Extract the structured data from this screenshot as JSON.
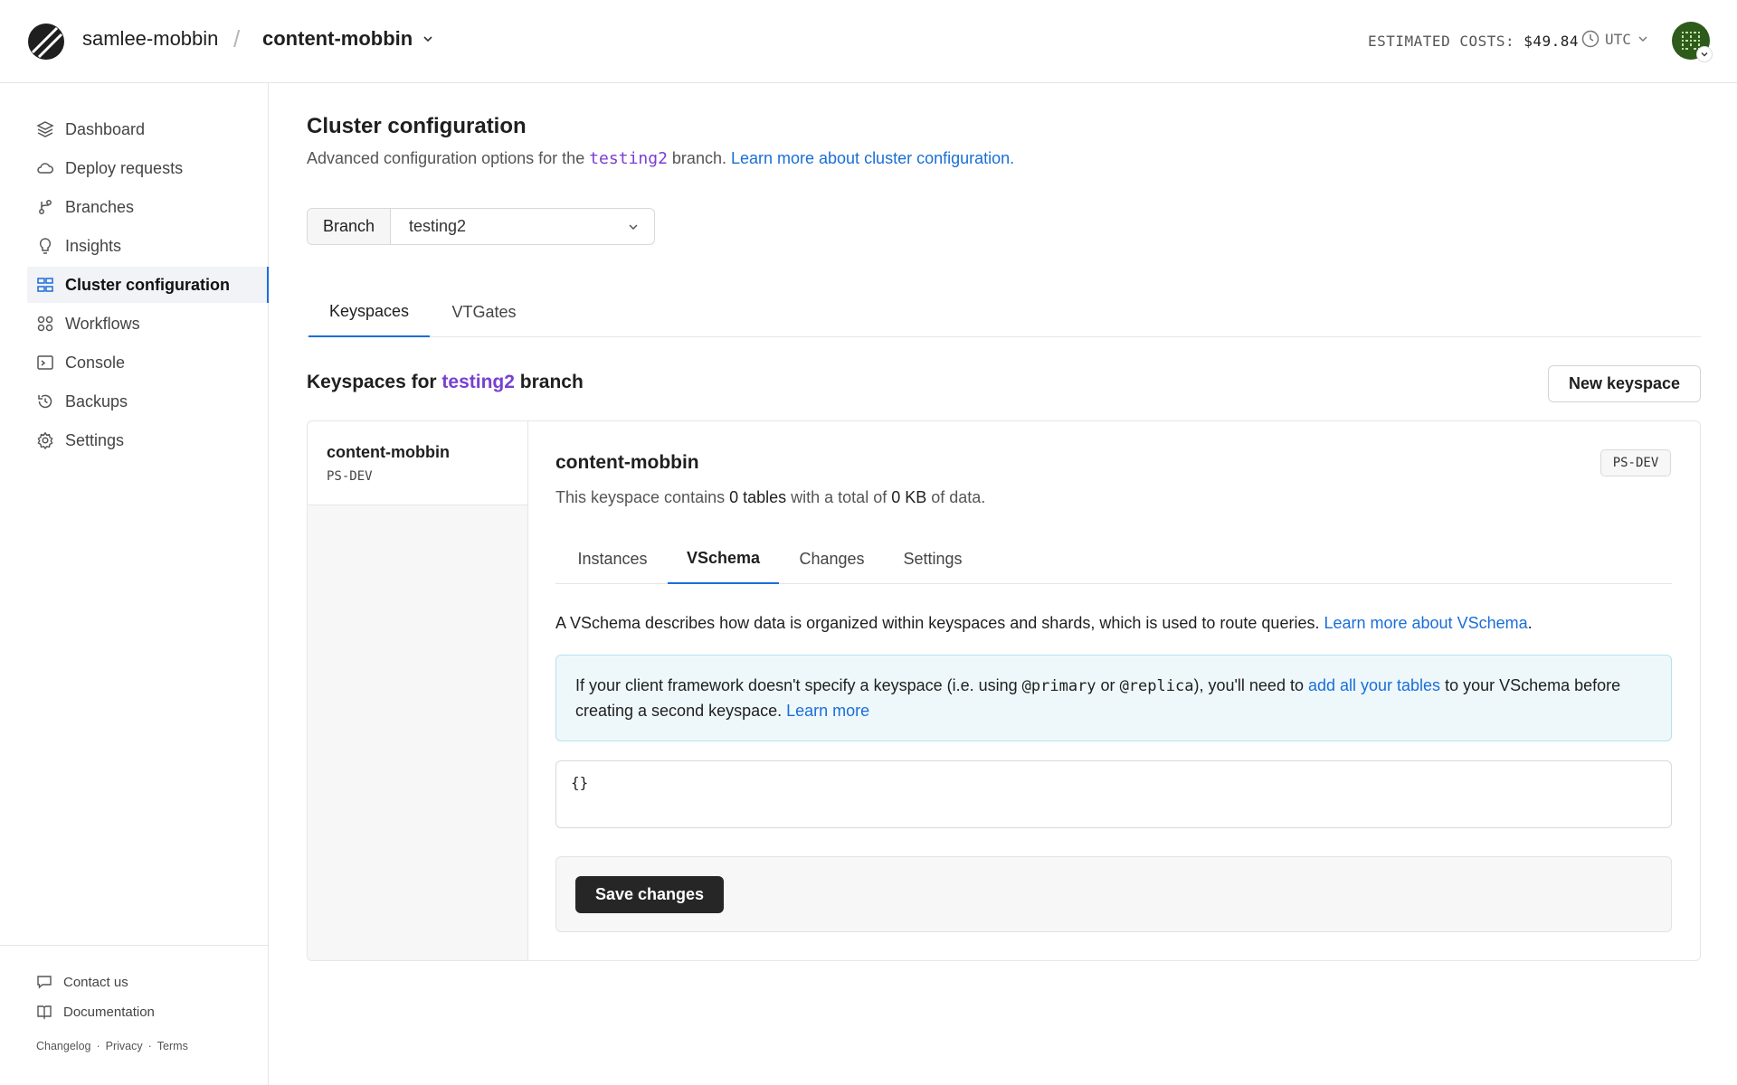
{
  "header": {
    "org": "samlee-mobbin",
    "separator": "/",
    "database": "content-mobbin",
    "costs_label": "ESTIMATED COSTS:",
    "costs_value": "$49.84",
    "timezone": "UTC"
  },
  "sidebar": {
    "items": [
      {
        "label": "Dashboard",
        "icon": "layers-icon"
      },
      {
        "label": "Deploy requests",
        "icon": "cloud-icon"
      },
      {
        "label": "Branches",
        "icon": "branch-icon"
      },
      {
        "label": "Insights",
        "icon": "lightbulb-icon"
      },
      {
        "label": "Cluster configuration",
        "icon": "cluster-icon",
        "active": true
      },
      {
        "label": "Workflows",
        "icon": "workflows-icon"
      },
      {
        "label": "Console",
        "icon": "terminal-icon"
      },
      {
        "label": "Backups",
        "icon": "backup-icon"
      },
      {
        "label": "Settings",
        "icon": "gear-icon"
      }
    ],
    "footer": {
      "contact": "Contact us",
      "docs": "Documentation",
      "links": [
        "Changelog",
        "Privacy",
        "Terms"
      ],
      "dot": "·"
    }
  },
  "page": {
    "title": "Cluster configuration",
    "subtitle_pre": "Advanced configuration options for the ",
    "subtitle_branch": "testing2",
    "subtitle_mid": " branch. ",
    "subtitle_link": "Learn more about cluster configuration."
  },
  "branch_select": {
    "label": "Branch",
    "value": "testing2"
  },
  "top_tabs": [
    "Keyspaces",
    "VTGates"
  ],
  "keyspaces": {
    "heading_pre": "Keyspaces for ",
    "heading_branch": "testing2",
    "heading_post": " branch",
    "new_button": "New keyspace",
    "list": [
      {
        "name": "content-mobbin",
        "tier": "PS-DEV"
      }
    ]
  },
  "detail": {
    "name": "content-mobbin",
    "tag": "PS-DEV",
    "desc_pre": "This keyspace contains ",
    "tables": "0 tables",
    "desc_mid": " with a total of ",
    "size": "0 KB",
    "desc_post": " of data.",
    "tabs": [
      "Instances",
      "VSchema",
      "Changes",
      "Settings"
    ],
    "active_tab": "VSchema"
  },
  "vschema": {
    "desc": "A VSchema describes how data is organized within keyspaces and shards, which is used to route queries. ",
    "desc_link": "Learn more about VSchema",
    "desc_end": ".",
    "callout_1": "If your client framework doesn't specify a keyspace (i.e. using ",
    "callout_code1": "@primary",
    "callout_2": " or ",
    "callout_code2": "@replica",
    "callout_3": "), you'll need to ",
    "callout_link": "add all your tables",
    "callout_4": " to your VSchema before creating a second keyspace. ",
    "callout_link2": "Learn more",
    "editor_value": "{}",
    "save_button": "Save changes"
  }
}
